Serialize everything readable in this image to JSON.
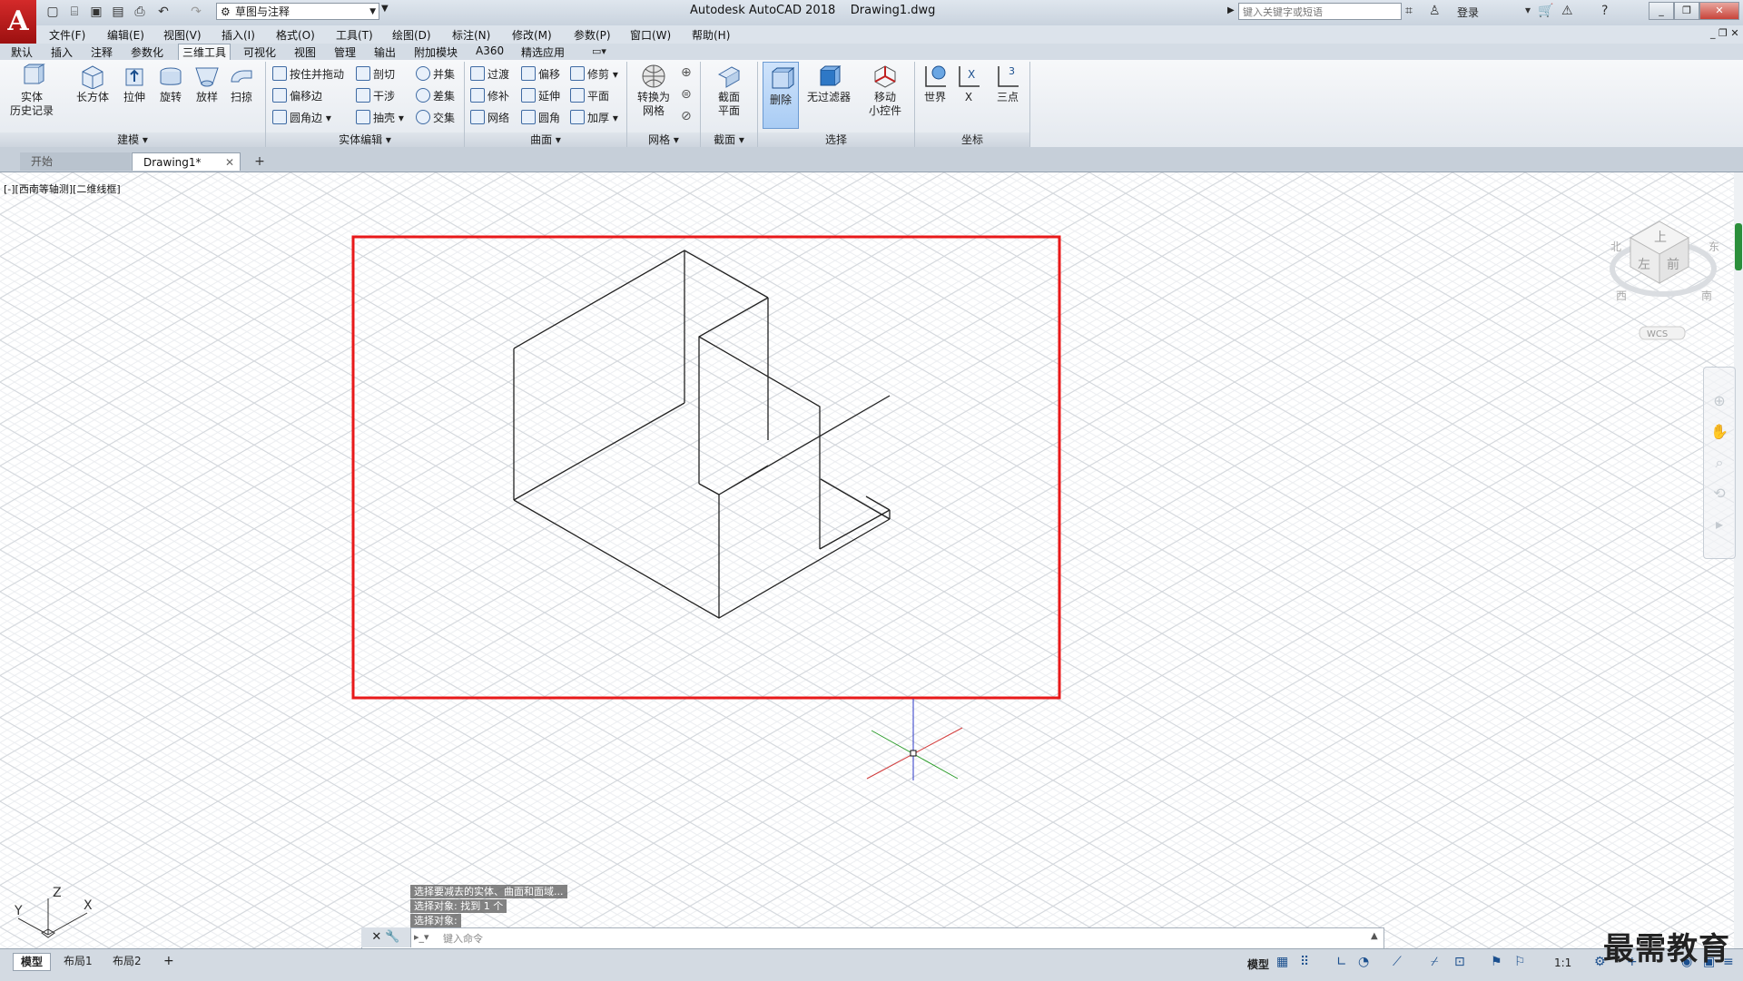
{
  "title_bar": {
    "app_title": "Autodesk AutoCAD 2018    Drawing1.dwg",
    "workspace": "草图与注释",
    "search_placeholder": "键入关键字或短语",
    "login": "登录"
  },
  "menu": [
    "文件(F)",
    "编辑(E)",
    "视图(V)",
    "插入(I)",
    "格式(O)",
    "工具(T)",
    "绘图(D)",
    "标注(N)",
    "修改(M)",
    "参数(P)",
    "窗口(W)",
    "帮助(H)"
  ],
  "ribbon_tabs": [
    "默认",
    "插入",
    "注释",
    "参数化",
    "三维工具",
    "可视化",
    "视图",
    "管理",
    "输出",
    "附加模块",
    "A360",
    "精选应用"
  ],
  "ribbon": {
    "modeling": {
      "history_label": "实体\n历史记录",
      "box": "长方体",
      "extrude": "拉伸",
      "revolve": "旋转",
      "loft": "放样",
      "sweep": "扫掠",
      "footer": "建模"
    },
    "solid_edit": {
      "items": [
        "按住并拖动",
        "偏移边",
        "圆角边",
        "剖切",
        "干涉",
        "抽壳",
        "并集",
        "差集",
        "交集"
      ],
      "footer": "实体编辑"
    },
    "surface": {
      "items": [
        "过渡",
        "修补",
        "网络",
        "偏移",
        "延伸",
        "圆角",
        "修剪",
        "平面",
        "加厚"
      ],
      "footer": "曲面"
    },
    "mesh": {
      "convert": "转换为\n网格",
      "footer": "网格"
    },
    "section": {
      "plane": "截面\n平面",
      "footer": "截面"
    },
    "selection": {
      "delete": "删除",
      "no_filter": "无过滤器",
      "gizmo": "移动\n小控件",
      "footer": "选择"
    },
    "coords": {
      "world": "世界",
      "x": "X",
      "three_point": "三点",
      "footer": "坐标"
    }
  },
  "doc_tabs": {
    "start": "开始",
    "drawing": "Drawing1*"
  },
  "viewport_label": "[-][西南等轴测][二维线框]",
  "viewcube": {
    "top": "上",
    "left": "左",
    "front": "前",
    "west": "西",
    "south": "南",
    "east": "东",
    "wcs": "WCS"
  },
  "ucs": {
    "x": "X",
    "y": "Y",
    "z": "Z"
  },
  "command": {
    "history": [
      "选择要减去的实体、曲面和面域...",
      "选择对象: 找到 1 个",
      "选择对象:"
    ],
    "placeholder": "键入命令"
  },
  "layout_tabs": [
    "模型",
    "布局1",
    "布局2"
  ],
  "status": {
    "model": "模型",
    "scale": "1:1"
  },
  "watermark": "最需教育",
  "colors": {
    "selection_rect": "#e8191a",
    "accent": "#d42a2a"
  }
}
